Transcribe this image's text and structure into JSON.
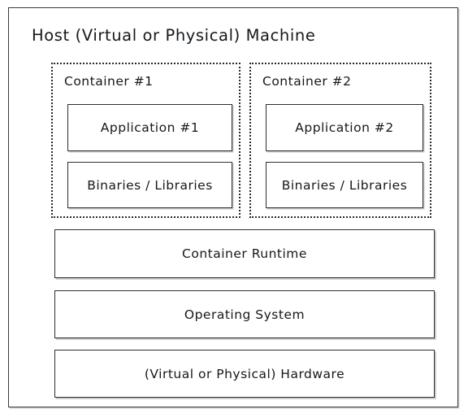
{
  "diagram": {
    "type": "layered-architecture",
    "title": "Host (Virtual or Physical) Machine",
    "style": "hand-drawn sketch",
    "background_color": "#ffffff",
    "stroke_color": "#2e2e2e",
    "text_color": "#14181c",
    "containers": [
      {
        "label": "Container #1",
        "border_style": "dotted",
        "children": [
          {
            "label": "Application #1",
            "border_style": "solid"
          },
          {
            "label": "Binaries / Libraries",
            "border_style": "solid"
          }
        ]
      },
      {
        "label": "Container #2",
        "border_style": "dotted",
        "children": [
          {
            "label": "Application #2",
            "border_style": "solid"
          },
          {
            "label": "Binaries / Libraries",
            "border_style": "solid"
          }
        ]
      }
    ],
    "layers": [
      {
        "label": "Container Runtime"
      },
      {
        "label": "Operating System"
      },
      {
        "label": "(Virtual or Physical) Hardware"
      }
    ]
  }
}
